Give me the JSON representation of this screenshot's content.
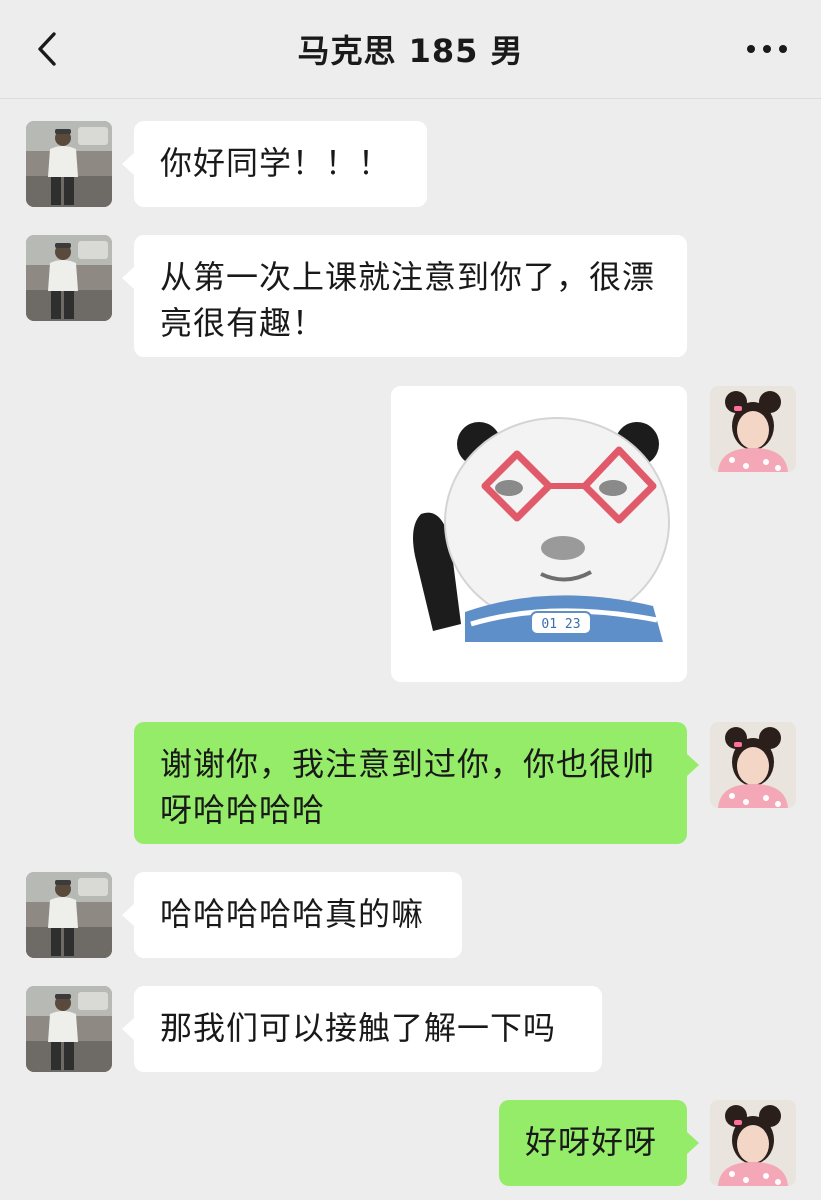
{
  "header": {
    "title": "马克思 185 男",
    "back_icon": "chevron-left-icon",
    "more_icon": "more-horizontal-icon"
  },
  "messages": [
    {
      "side": "left",
      "type": "text",
      "text": "你好同学！！！"
    },
    {
      "side": "left",
      "type": "text",
      "text": "从第一次上课就注意到你了，很漂亮很有趣！"
    },
    {
      "side": "right",
      "type": "sticker",
      "sticker": "panda-sticker",
      "sticker_label": "01 23"
    },
    {
      "side": "right",
      "type": "text",
      "text": "谢谢你，我注意到过你，你也很帅呀哈哈哈哈"
    },
    {
      "side": "left",
      "type": "text",
      "text": "哈哈哈哈哈真的嘛"
    },
    {
      "side": "left",
      "type": "text",
      "text": "那我们可以接触了解一下吗"
    },
    {
      "side": "right",
      "type": "text",
      "text": "好呀好呀"
    }
  ],
  "colors": {
    "background": "#ededed",
    "bubble_self": "#95ec69",
    "bubble_other": "#ffffff"
  }
}
